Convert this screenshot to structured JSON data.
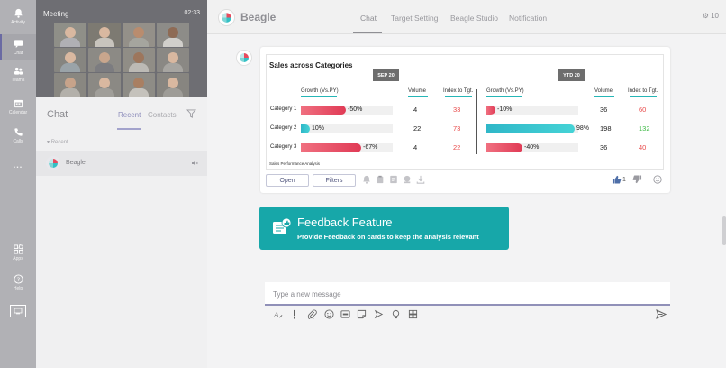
{
  "rail": {
    "items": [
      {
        "label": "Activity"
      },
      {
        "label": "Chat"
      },
      {
        "label": "Teams"
      },
      {
        "label": "Calendar"
      },
      {
        "label": "Calls"
      },
      {
        "label": "..."
      },
      {
        "label": "Apps"
      },
      {
        "label": "Help"
      }
    ]
  },
  "meeting": {
    "title": "Meeting",
    "time": "02:33"
  },
  "chat_panel": {
    "title": "Chat",
    "tab_recent": "Recent",
    "tab_contacts": "Contacts",
    "recent_header": "Recent",
    "conversation": {
      "name": "Beagle"
    }
  },
  "header": {
    "app_name": "Beagle",
    "tabs": [
      {
        "label": "Chat",
        "active": true
      },
      {
        "label": "Target Setting"
      },
      {
        "label": "Beagle Studio"
      },
      {
        "label": "Notification"
      }
    ],
    "right_text": "10"
  },
  "card": {
    "title": "Sales across Categories",
    "periods": [
      "SEP 20",
      "YTD 20"
    ],
    "columns": {
      "growth": "Growth (Vs.PY)",
      "volume": "Volume",
      "index": "Index to Tgt."
    },
    "rows": [
      {
        "category": "Category 1",
        "sep": {
          "growth": "-50%",
          "growth_value": -50,
          "volume": "4",
          "index": "33"
        },
        "ytd": {
          "growth": "-10%",
          "growth_value": -10,
          "volume": "36",
          "index": "60"
        }
      },
      {
        "category": "Category 2",
        "sep": {
          "growth": "10%",
          "growth_value": 10,
          "volume": "22",
          "index": "73"
        },
        "ytd": {
          "growth": "98%",
          "growth_value": 98,
          "volume": "198",
          "index": "132"
        }
      },
      {
        "category": "Category 3",
        "sep": {
          "growth": "-67%",
          "growth_value": -67,
          "volume": "4",
          "index": "22"
        },
        "ytd": {
          "growth": "-40%",
          "growth_value": -40,
          "volume": "36",
          "index": "40"
        }
      }
    ],
    "footer": "Sales Performance Analysis",
    "open_label": "Open",
    "filters_label": "Filters",
    "like_count": "1",
    "colors": {
      "negative": "#e8405a",
      "positive": "#2fbfcf",
      "index_bad": "#e84a4a",
      "index_good": "#3cb843"
    }
  },
  "feedback": {
    "title": "Feedback Feature",
    "subtitle": "Provide Feedback on cards to keep the analysis relevant"
  },
  "compose": {
    "placeholder": "Type a new message"
  }
}
